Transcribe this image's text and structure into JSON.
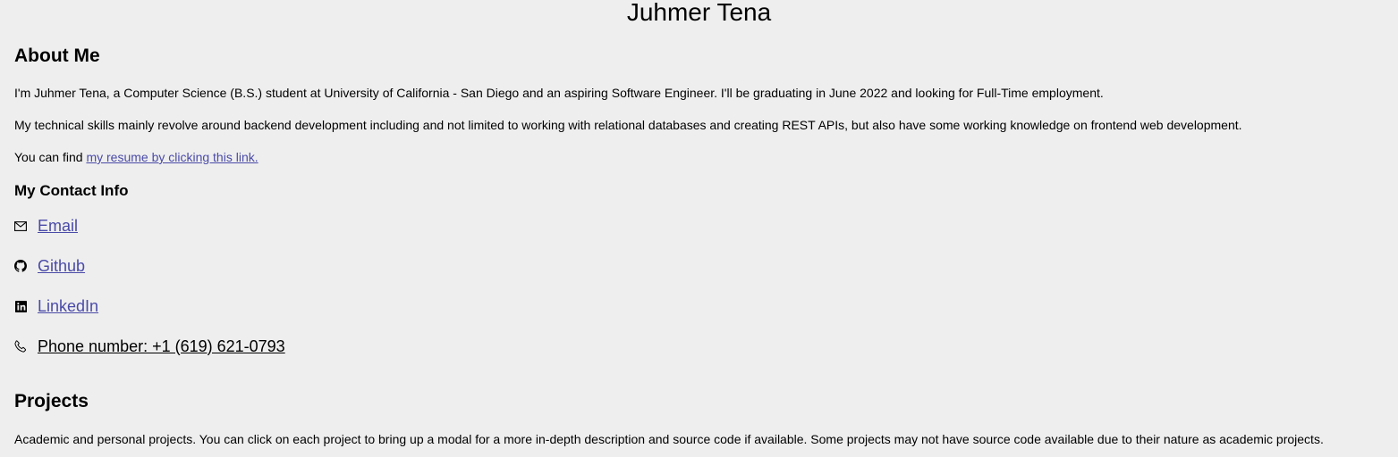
{
  "header": {
    "name": "Juhmer Tena"
  },
  "about": {
    "title": "About Me",
    "paragraph1": "I'm Juhmer Tena, a Computer Science (B.S.) student at University of California - San Diego and an aspiring Software Engineer. I'll be graduating in June 2022 and looking for Full-Time employment.",
    "paragraph2": "My technical skills mainly revolve around backend development including and not limited to working with relational databases and creating REST APIs, but also have some working knowledge on frontend web development.",
    "resume_prefix": "You can find ",
    "resume_link": "my resume by clicking this link."
  },
  "contact": {
    "title": "My Contact Info",
    "items": [
      {
        "icon": "mail-icon",
        "label": "Email"
      },
      {
        "icon": "github-icon",
        "label": "Github"
      },
      {
        "icon": "linkedin-icon",
        "label": "LinkedIn"
      },
      {
        "icon": "phone-icon",
        "label": "Phone number: +1 (619) 621-0793"
      }
    ]
  },
  "projects": {
    "title": "Projects",
    "description": "Academic and personal projects. You can click on each project to bring up a modal for a more in-depth description and source code if available. Some projects may not have source code available due to their nature as academic projects."
  },
  "colors": {
    "background": "#eeeeee",
    "link": "#4a4aa8",
    "text": "#000000"
  }
}
